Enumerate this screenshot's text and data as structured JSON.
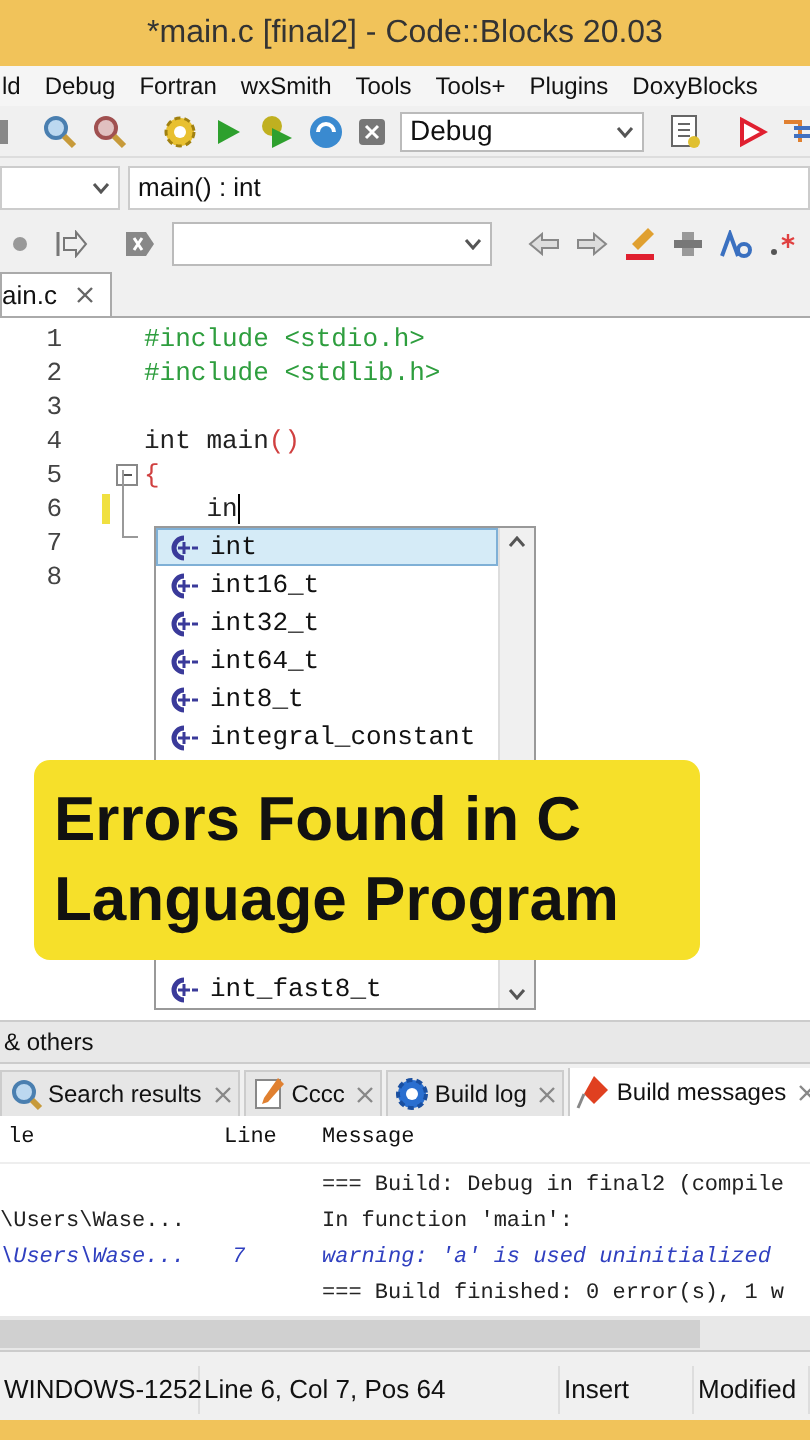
{
  "window": {
    "title": "*main.c [final2] - Code::Blocks 20.03"
  },
  "menu": [
    "ld",
    "Debug",
    "Fortran",
    "wxSmith",
    "Tools",
    "Tools+",
    "Plugins",
    "DoxyBlocks"
  ],
  "toolbar": {
    "build_target": "Debug"
  },
  "code_toolbar": {
    "scope": "main() : int"
  },
  "editor": {
    "tab": "ain.c",
    "lines": [
      {
        "number": "1",
        "modified": false,
        "segments": [
          {
            "kind": "preprocessor",
            "text": "#include <stdio.h>"
          }
        ]
      },
      {
        "number": "2",
        "modified": false,
        "segments": [
          {
            "kind": "preprocessor",
            "text": "#include <stdlib.h>"
          }
        ]
      },
      {
        "number": "3",
        "modified": false
      },
      {
        "number": "4",
        "modified": false,
        "segments": [
          {
            "kind": "plain",
            "text": "int main"
          },
          {
            "kind": "operator",
            "text": "()"
          }
        ]
      },
      {
        "number": "5",
        "modified": false,
        "segments": [
          {
            "kind": "operator",
            "text": "{"
          }
        ]
      },
      {
        "number": "6",
        "modified": true,
        "segments": [
          {
            "kind": "plain",
            "text": "    in"
          }
        ]
      },
      {
        "number": "7",
        "modified": false
      },
      {
        "number": "8",
        "modified": false
      }
    ],
    "autocomplete": {
      "items": [
        {
          "label": "int",
          "selected": true
        },
        {
          "label": "int16_t",
          "selected": false
        },
        {
          "label": "int32_t",
          "selected": false
        },
        {
          "label": "int64_t",
          "selected": false
        },
        {
          "label": "int8_t",
          "selected": false
        },
        {
          "label": "integral_constant",
          "selected": false
        }
      ],
      "last_visible_item": "int_fast8_t"
    }
  },
  "banner": {
    "lines": [
      "Errors Found in C",
      "Language Program"
    ]
  },
  "panel": {
    "title": "& others",
    "tabs": [
      {
        "label": "Search results",
        "selected": false
      },
      {
        "label": "Cccc",
        "selected": false
      },
      {
        "label": "Build log",
        "selected": false
      },
      {
        "label": "Build messages",
        "selected": true
      }
    ],
    "columns": [
      "le",
      "Line",
      "Message"
    ],
    "rows": [
      {
        "kind": "info",
        "message": "=== Build: Debug in final2 (compile"
      },
      {
        "kind": "info",
        "file": "\\Users\\Wase...",
        "message": "In function 'main':"
      },
      {
        "kind": "warning",
        "file": "\\Users\\Wase...",
        "line": "7",
        "message": "warning: 'a' is used uninitialized"
      },
      {
        "kind": "info",
        "message": "=== Build finished: 0 error(s), 1 w"
      }
    ]
  },
  "status_bar": [
    "WINDOWS-1252",
    "Line 6, Col 7, Pos 64",
    "Insert",
    "Modified"
  ]
}
